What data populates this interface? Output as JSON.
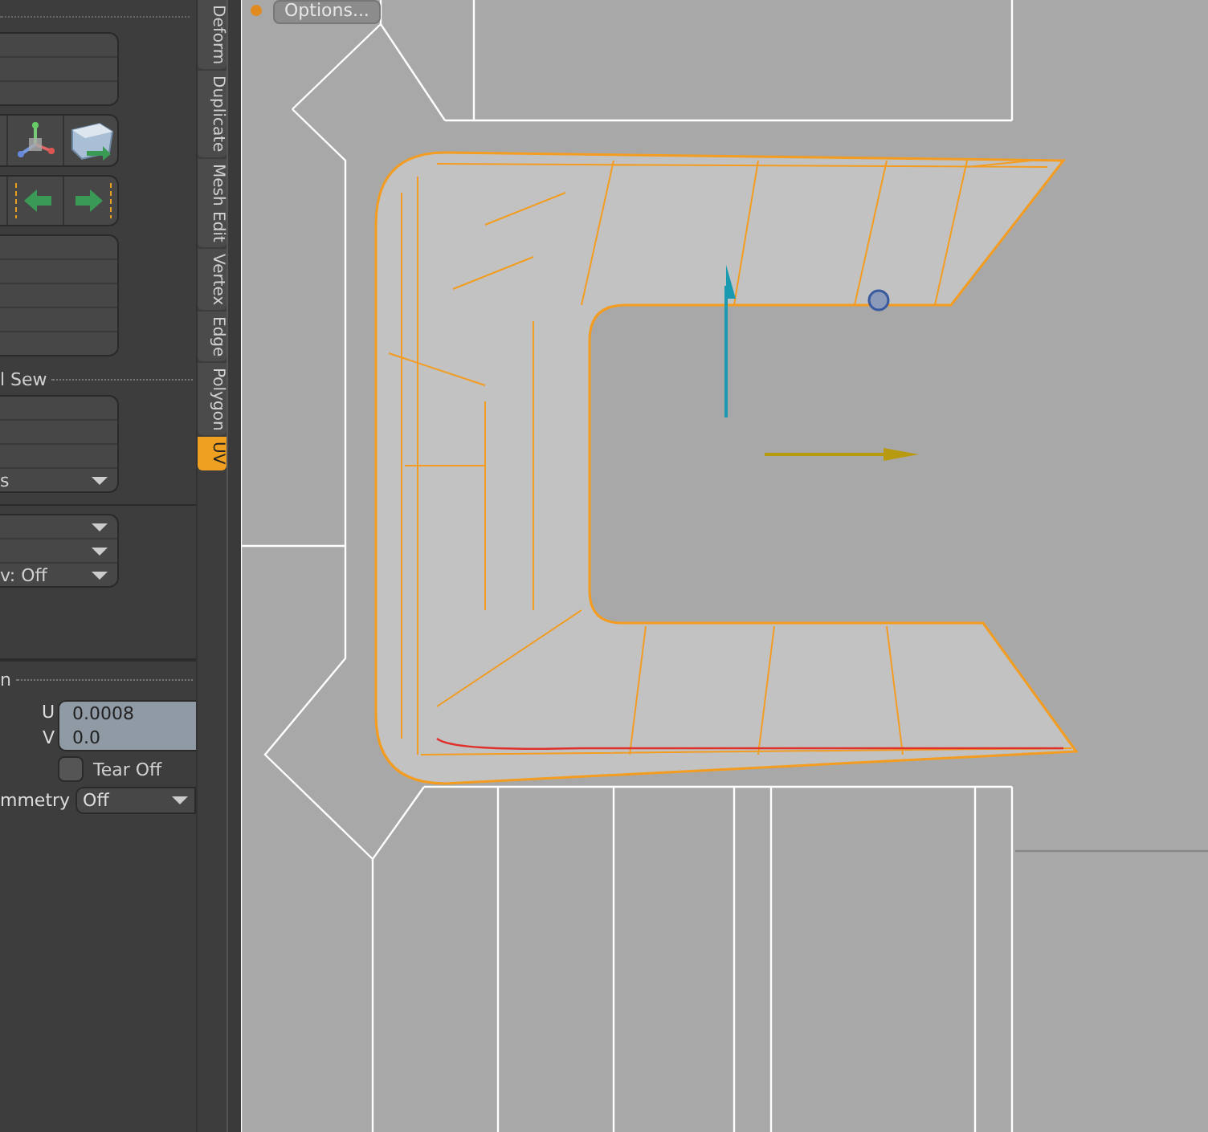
{
  "viewport_header": {
    "options_button": "Options..."
  },
  "side_tabs": [
    {
      "label": "Deform",
      "selected": false
    },
    {
      "label": "Duplicate",
      "selected": false
    },
    {
      "label": "Mesh Edit",
      "selected": false
    },
    {
      "label": "Vertex",
      "selected": false
    },
    {
      "label": "Edge",
      "selected": false
    },
    {
      "label": "Polygon",
      "selected": false
    },
    {
      "label": "UV",
      "selected": true
    }
  ],
  "tool_panel": {
    "sew_label": "l Sew",
    "sew_list_last_row": "s",
    "partial_dropdown": "v: Off",
    "section_label": "n",
    "uv_offset": {
      "u_label": "U",
      "u_value": "0.0008",
      "v_label": "V",
      "v_value": "0.0"
    },
    "tear_off": {
      "label": "Tear Off",
      "checked": false
    },
    "symmetry": {
      "label": "mmetry",
      "value": "Off"
    }
  }
}
